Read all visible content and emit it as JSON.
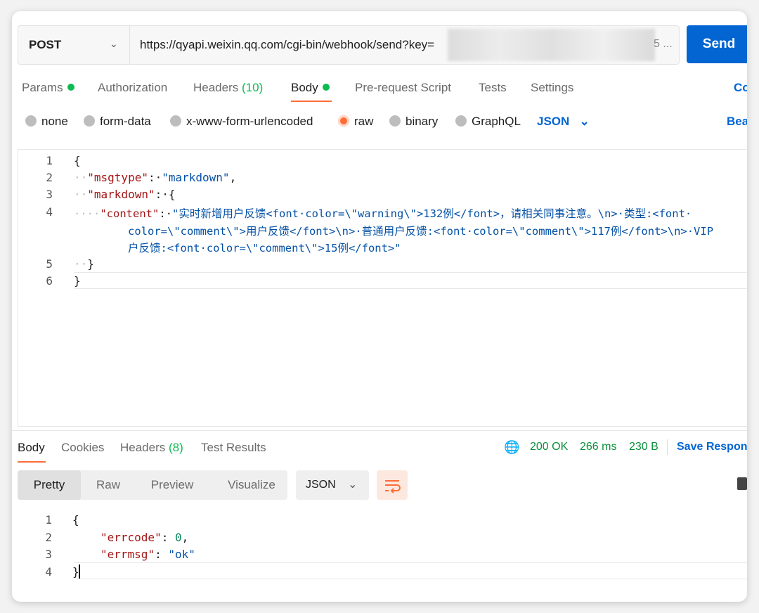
{
  "request": {
    "method": "POST",
    "url": "https://qyapi.weixin.qq.com/cgi-bin/webhook/send?key=",
    "url_tail": "5 ...",
    "send_label": "Send"
  },
  "req_tabs": {
    "params": "Params",
    "authorization": "Authorization",
    "headers": "Headers",
    "headers_count": "(10)",
    "body": "Body",
    "pre_request": "Pre-request Script",
    "tests": "Tests",
    "settings": "Settings",
    "cookies_cut": "Co"
  },
  "body_types": {
    "none": "none",
    "form_data": "form-data",
    "urlencoded": "x-www-form-urlencoded",
    "raw": "raw",
    "binary": "binary",
    "graphql": "GraphQL",
    "format": "JSON",
    "beautify_cut": "Bea"
  },
  "request_body": {
    "line_numbers": [
      "1",
      "2",
      "3",
      "4",
      "5",
      "6"
    ],
    "l1": "{",
    "l2_key": "\"msgtype\"",
    "l2_val": "\"markdown\"",
    "l3_key": "\"markdown\"",
    "l3_brace": "{",
    "l4_key": "\"content\"",
    "l4_val_a": "\"实时新增用户反馈<font·color=\\\"warning\\\">132例</font>，请相关同事注意。\\n>·类型:<font·",
    "l4_val_b": "color=\\\"comment\\\">用户反馈</font>\\n>·普通用户反馈:<font·color=\\\"comment\\\">117例</font>\\n>·VIP",
    "l4_val_c": "户反馈:<font·color=\\\"comment\\\">15例</font>\"",
    "l5": "}",
    "l6": "}"
  },
  "resp_tabs": {
    "body": "Body",
    "cookies": "Cookies",
    "headers": "Headers",
    "headers_count": "(8)",
    "test_results": "Test Results"
  },
  "resp_status": {
    "code": "200 OK",
    "time": "266 ms",
    "size": "230 B",
    "save_cut": "Save Respon"
  },
  "resp_view": {
    "pretty": "Pretty",
    "raw": "Raw",
    "preview": "Preview",
    "visualize": "Visualize",
    "format": "JSON"
  },
  "response_body": {
    "line_numbers": [
      "1",
      "2",
      "3",
      "4"
    ],
    "l1": "{",
    "l2_key": "\"errcode\"",
    "l2_val": "0",
    "l3_key": "\"errmsg\"",
    "l3_val": "\"ok\"",
    "l4": "}"
  },
  "colors": {
    "accent": "#ff6c37",
    "send": "#0265d2",
    "status_ok": "#0a8f3c",
    "dot": "#0cbb52"
  }
}
